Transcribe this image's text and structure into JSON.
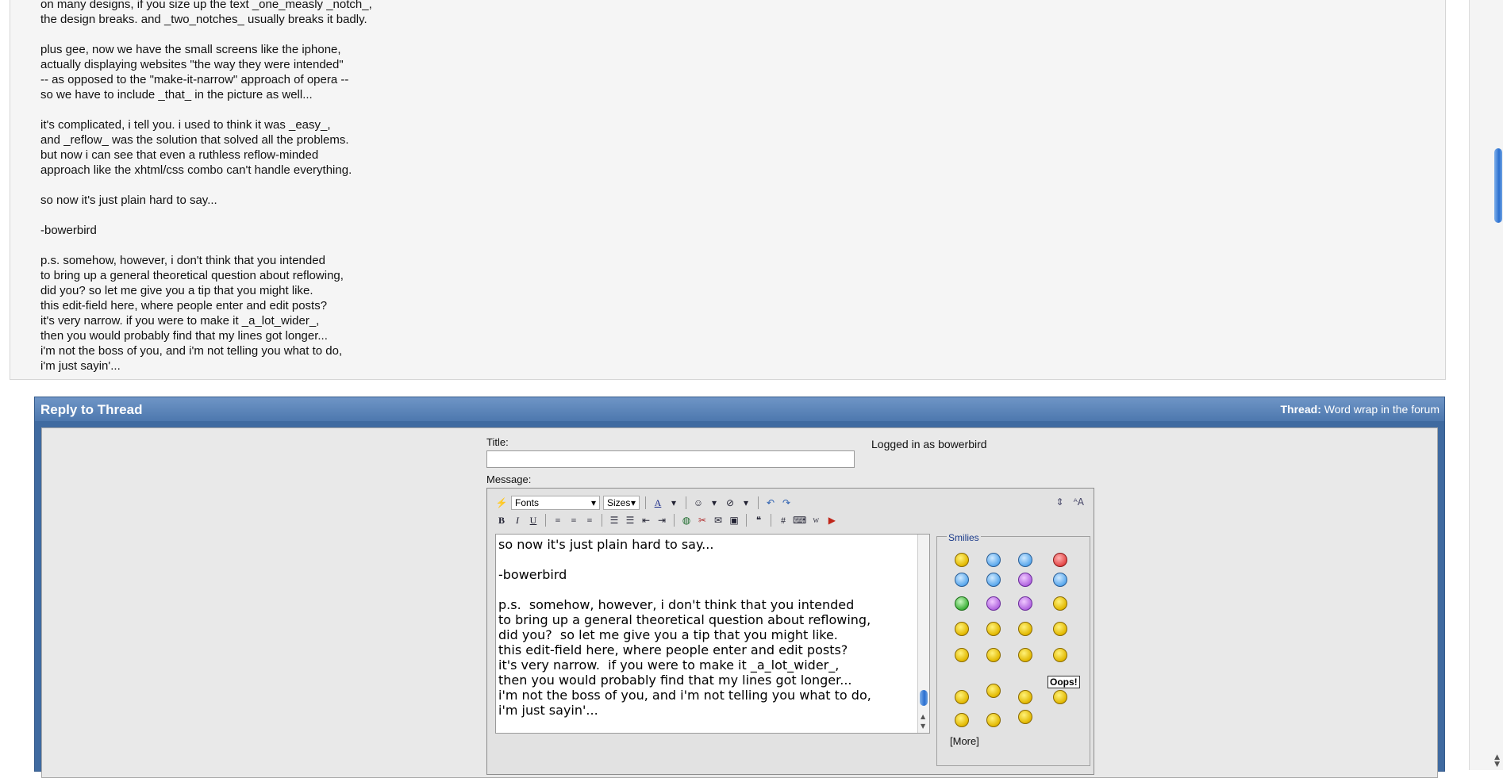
{
  "post": {
    "lines": [
      "on many designs, if you size up the text _one_measly _notch_,",
      "the design breaks. and _two_notches_ usually breaks it badly.",
      "",
      "plus gee, now we have the small screens like the iphone,",
      "actually displaying websites \"the way they were intended\"",
      "-- as opposed to the \"make-it-narrow\" approach of opera --",
      "so we have to include _that_ in the picture as well...",
      "",
      "it's complicated, i tell you. i used to think it was _easy_,",
      "and _reflow_ was the solution that solved all the problems.",
      "but now i can see that even a ruthless reflow-minded",
      "approach like the xhtml/css combo can't handle everything.",
      "",
      "so now it's just plain hard to say...",
      "",
      "-bowerbird",
      "",
      "p.s. somehow, however, i don't think that you intended",
      "to bring up a general theoretical question about reflowing,",
      "did you? so let me give you a tip that you might like.",
      "this edit-field here, where people enter and edit posts?",
      "it's very narrow. if you were to make it _a_lot_wider_,",
      "then you would probably find that my lines got longer...",
      "i'm not the boss of you, and i'm not telling you what to do,",
      "i'm just sayin'..."
    ]
  },
  "reply": {
    "header_title": "Reply to Thread",
    "thread_label": "Thread",
    "thread_name": "Word wrap in the forum",
    "title_label": "Title:",
    "message_label": "Message:",
    "logged_in": "Logged in as bowerbird"
  },
  "editor": {
    "fonts_label": "Fonts",
    "sizes_label": "Sizes",
    "bold": "B",
    "italic": "I",
    "underline": "U",
    "hash": "#",
    "message_lines": [
      "",
      "so now it's just plain hard to say...",
      "",
      "-bowerbird",
      "",
      "p.s.  somehow, however, i don't think that you intended",
      "to bring up a general theoretical question about reflowing,",
      "did you?  so let me give you a tip that you might like.",
      "this edit-field here, where people enter and edit posts?",
      "it's very narrow.  if you were to make it _a_lot_wider_,",
      "then you would probably find that my lines got longer...",
      "i'm not the boss of you, and i'm not telling you what to do,",
      "i'm just sayin'..."
    ]
  },
  "smilies": {
    "legend": "Smilies",
    "more": "[More]",
    "oops": "Oops!"
  }
}
